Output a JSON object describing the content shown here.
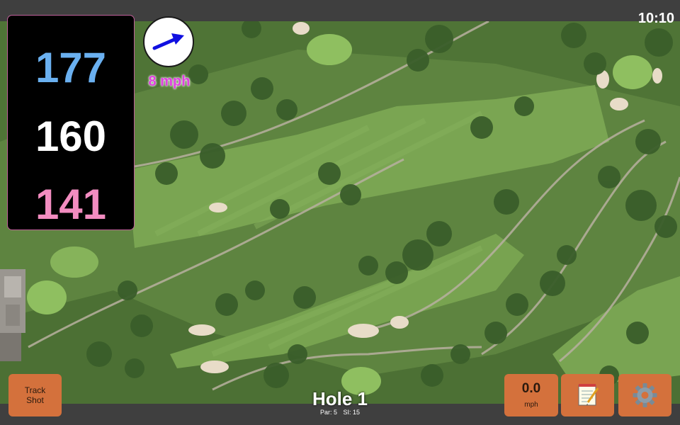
{
  "status_bar": {
    "time": "10:10"
  },
  "distances": {
    "back": "177",
    "middle": "160",
    "front": "141"
  },
  "wind": {
    "speed": "8 mph",
    "icon": "wind-arrow-icon",
    "color": "#1010e0"
  },
  "hole": {
    "title": "Hole 1",
    "par_label": "Par: 5",
    "si_label": "SI: 15"
  },
  "buttons": {
    "track_shot_line1": "Track",
    "track_shot_line2": "Shot",
    "speed_value": "0.0",
    "speed_unit": "mph",
    "notes_icon": "notepad-icon",
    "settings_icon": "gear-icon"
  },
  "colors": {
    "back": "#6ab0f0",
    "middle": "#ffffff",
    "front": "#f28cc0",
    "button": "#d4713c",
    "wind_text": "#e040e0"
  }
}
